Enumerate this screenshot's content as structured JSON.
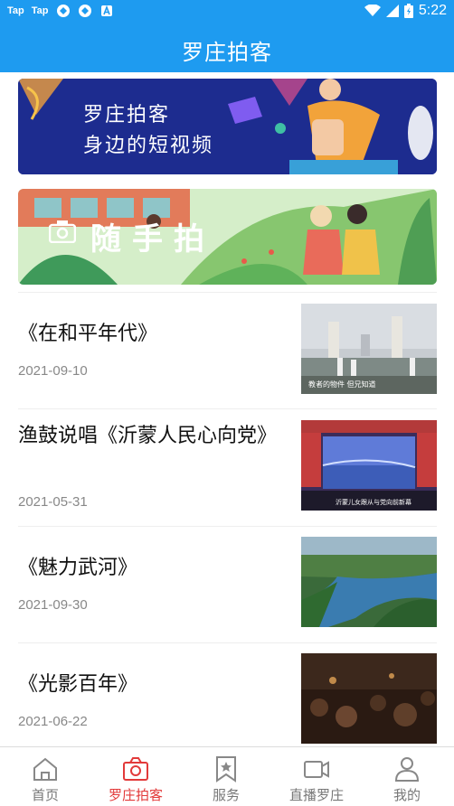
{
  "status_bar": {
    "left_items": [
      "Tap",
      "Tap"
    ],
    "time": "5:22"
  },
  "header": {
    "title": "罗庄拍客"
  },
  "banners": [
    {
      "line1": "罗庄拍客",
      "line2": "身边的短视频"
    },
    {
      "text": "随手拍"
    }
  ],
  "news": [
    {
      "title": "《在和平年代》",
      "date": "2021-09-10",
      "thumb_caption": "教者的物件 但兄知道"
    },
    {
      "title": "渔鼓说唱《沂蒙人民心向党》",
      "date": "2021-05-31",
      "thumb_caption": "沂蒙儿女跟从与党向前新幕"
    },
    {
      "title": "《魅力武河》",
      "date": "2021-09-30",
      "thumb_caption": ""
    },
    {
      "title": "《光影百年》",
      "date": "2021-06-22",
      "thumb_caption": ""
    }
  ],
  "tabs": [
    {
      "label": "首页",
      "icon": "home-icon",
      "active": false
    },
    {
      "label": "罗庄拍客",
      "icon": "camera-icon",
      "active": true
    },
    {
      "label": "服务",
      "icon": "bookmark-star-icon",
      "active": false
    },
    {
      "label": "直播罗庄",
      "icon": "video-icon",
      "active": false
    },
    {
      "label": "我的",
      "icon": "person-icon",
      "active": false
    }
  ],
  "colors": {
    "primary": "#1e9bf0",
    "active_tab": "#e23a3a",
    "inactive_tab": "#777777"
  }
}
